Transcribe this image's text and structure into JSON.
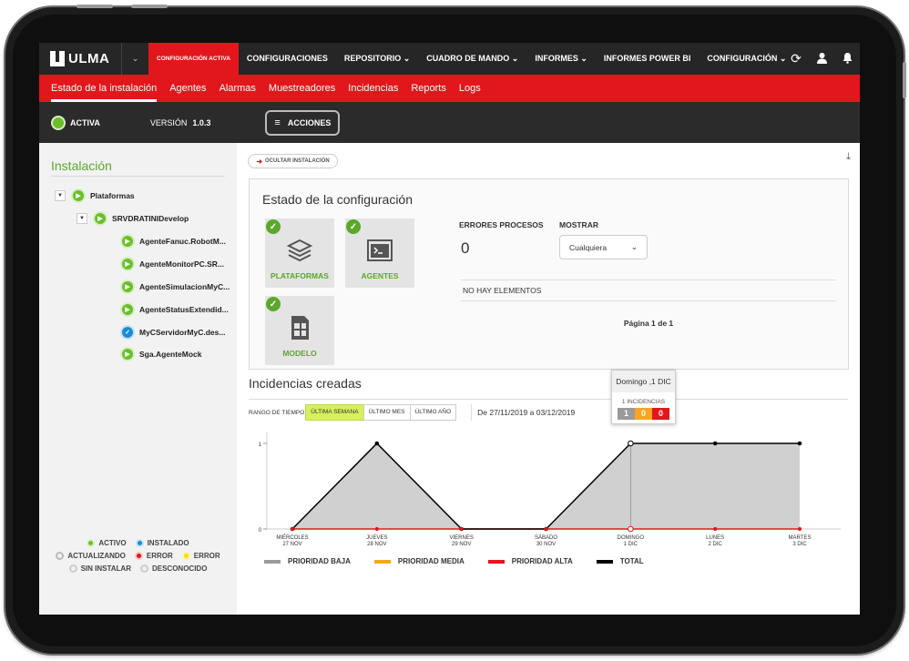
{
  "brand": {
    "name": "ULMA"
  },
  "topnav": {
    "items": [
      {
        "label": "CONFIGURACIÓN ACTIVA",
        "active": true
      },
      {
        "label": "CONFIGURACIONES"
      },
      {
        "label": "REPOSITORIO  ⌄"
      },
      {
        "label": "CUADRO DE MANDO  ⌄"
      },
      {
        "label": "INFORMES  ⌄"
      },
      {
        "label": "INFORMES POWER BI"
      },
      {
        "label": "CONFIGURACIÓN  ⌄"
      }
    ],
    "icons": [
      "refresh-icon",
      "user-icon",
      "bell-icon"
    ]
  },
  "subnav": {
    "items": [
      "Estado de la instalación",
      "Agentes",
      "Alarmas",
      "Muestreadores",
      "Incidencias",
      "Reports",
      "Logs"
    ]
  },
  "status": {
    "state": "ACTIVA",
    "version_label": "VERSIÓN",
    "version": "1.0.3",
    "actions": "ACCIONES"
  },
  "sidebar": {
    "title": "Instalación",
    "tree": {
      "root": "Plataformas",
      "server": "SRVDRATINIDevelop",
      "agents": [
        "AgenteFanuc.RobotM...",
        "AgenteMonitorPC.SR...",
        "AgenteSimulacionMyC...",
        "AgenteStatusExtendid...",
        "MyCServidorMyC.des...",
        "Sga.AgenteMock"
      ]
    },
    "legend": {
      "activo": "ACTIVO",
      "instalado": "INSTALADO",
      "actualizando": "ACTUALIZANDO",
      "error1": "ERROR",
      "error2": "ERROR",
      "sin_instalar": "SIN INSTALAR",
      "desconocido": "DESCONOCIDO"
    }
  },
  "main": {
    "hide_button": "OCULTAR INSTALACIÓN",
    "config": {
      "title": "Estado de la configuración",
      "cards": [
        "PLATAFORMAS",
        "AGENTES",
        "MODELO"
      ],
      "errors_label": "ERRORES PROCESOS",
      "errors_value": "0",
      "show_label": "MOSTRAR",
      "show_value": "Cualquiera",
      "empty": "NO HAY ELEMENTOS",
      "pagination": "Página 1 de 1"
    },
    "incidents": {
      "title": "Incidencias creadas",
      "range_label": "RANGO DE TIEMPO",
      "ranges": [
        "ÚLTIMA SEMANA",
        "ÚLTIMO MES",
        "ÚLTIMO AÑO"
      ],
      "dates": "De 27/11/2019 a 03/12/2019",
      "tooltip": {
        "title": "Domingo ,1 DIC",
        "count": "1 INCIDENCIAS",
        "low": "1",
        "medium": "0",
        "high": "0"
      }
    }
  },
  "colors": {
    "brand_red": "#e2171b",
    "green": "#5aa82b",
    "low": "#9a9a9a",
    "medium": "#f5a623",
    "high": "#e2171b",
    "total": "#000000"
  },
  "chart_data": {
    "type": "area",
    "categories": [
      [
        "MIÉRCOLES",
        "27 NOV"
      ],
      [
        "JUEVES",
        "28 NOV"
      ],
      [
        "VIERNES",
        "29 NOV"
      ],
      [
        "SÁBADO",
        "30 NOV"
      ],
      [
        "DOMINGO",
        "1 DIC"
      ],
      [
        "LUNES",
        "2 DIC"
      ],
      [
        "MARTES",
        "3 DIC"
      ]
    ],
    "yticks": [
      "0",
      "1"
    ],
    "ylim": [
      0,
      1
    ],
    "series": [
      {
        "name": "PRIORIDAD BAJA",
        "values": [
          0,
          1,
          0,
          0,
          1,
          1,
          1
        ]
      },
      {
        "name": "PRIORIDAD MEDIA",
        "values": [
          0,
          0,
          0,
          0,
          0,
          0,
          0
        ]
      },
      {
        "name": "PRIORIDAD ALTA",
        "values": [
          0,
          0,
          0,
          0,
          0,
          0,
          0
        ]
      },
      {
        "name": "TOTAL",
        "values": [
          0,
          1,
          0,
          0,
          1,
          1,
          1
        ]
      }
    ],
    "highlight_index": 4
  }
}
